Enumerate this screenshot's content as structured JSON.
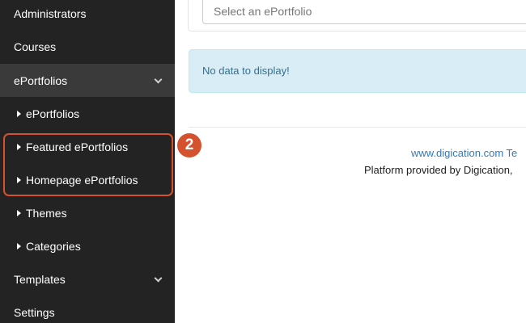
{
  "sidebar": {
    "items": [
      {
        "label": "Administrators"
      },
      {
        "label": "Courses"
      },
      {
        "label": "ePortfolios"
      },
      {
        "label": "ePortfolios"
      },
      {
        "label": "Featured ePortfolios"
      },
      {
        "label": "Homepage ePortfolios"
      },
      {
        "label": "Themes"
      },
      {
        "label": "Categories"
      },
      {
        "label": "Templates"
      },
      {
        "label": "Settings"
      }
    ]
  },
  "annotation": {
    "badge": "2",
    "color": "#d5522f"
  },
  "main": {
    "select_placeholder": "Select an ePortfolio",
    "alert_text": "No data to display!",
    "footer_link": "www.digication.com Te",
    "footer_text": "Platform provided by Digication,"
  },
  "colors": {
    "sidebar_bg": "#232323",
    "sidebar_active_bg": "#3a3a3a",
    "alert_bg": "#d9edf7",
    "alert_text": "#31708f",
    "link": "#337ab7"
  }
}
